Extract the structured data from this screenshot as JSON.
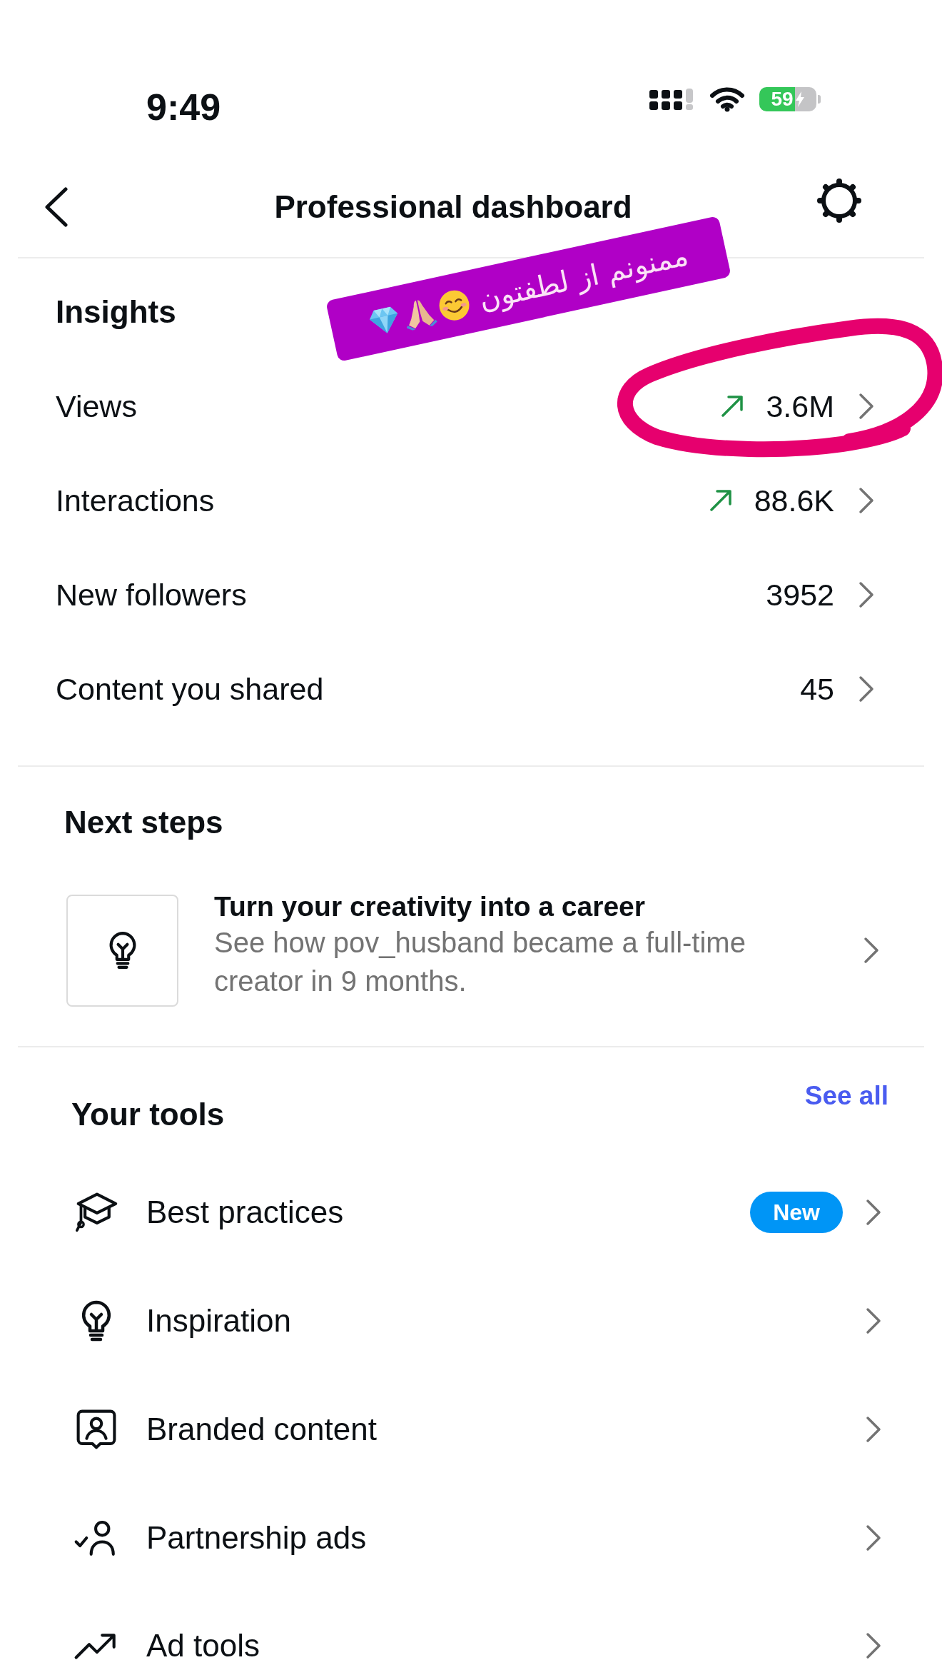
{
  "status_bar": {
    "time": "9:49",
    "battery": "59"
  },
  "header": {
    "title": "Professional dashboard"
  },
  "sticker": {
    "text": "ممنونم از لطفتون"
  },
  "insights": {
    "title": "Insights",
    "rows": [
      {
        "label": "Views",
        "value": "3.6M",
        "trending_up": true
      },
      {
        "label": "Interactions",
        "value": "88.6K",
        "trending_up": true
      },
      {
        "label": "New followers",
        "value": "3952",
        "trending_up": false
      },
      {
        "label": "Content you shared",
        "value": "45",
        "trending_up": false
      }
    ]
  },
  "next_steps": {
    "title": "Next steps",
    "cards": [
      {
        "title": "Turn your creativity into a career",
        "description": "See how pov_husband became a full-time creator in 9 months."
      }
    ]
  },
  "tools": {
    "title": "Your tools",
    "see_all": "See all",
    "items": [
      {
        "label": "Best practices",
        "badge": "New"
      },
      {
        "label": "Inspiration"
      },
      {
        "label": "Branded content"
      },
      {
        "label": "Partnership ads"
      },
      {
        "label": "Ad tools"
      }
    ]
  }
}
